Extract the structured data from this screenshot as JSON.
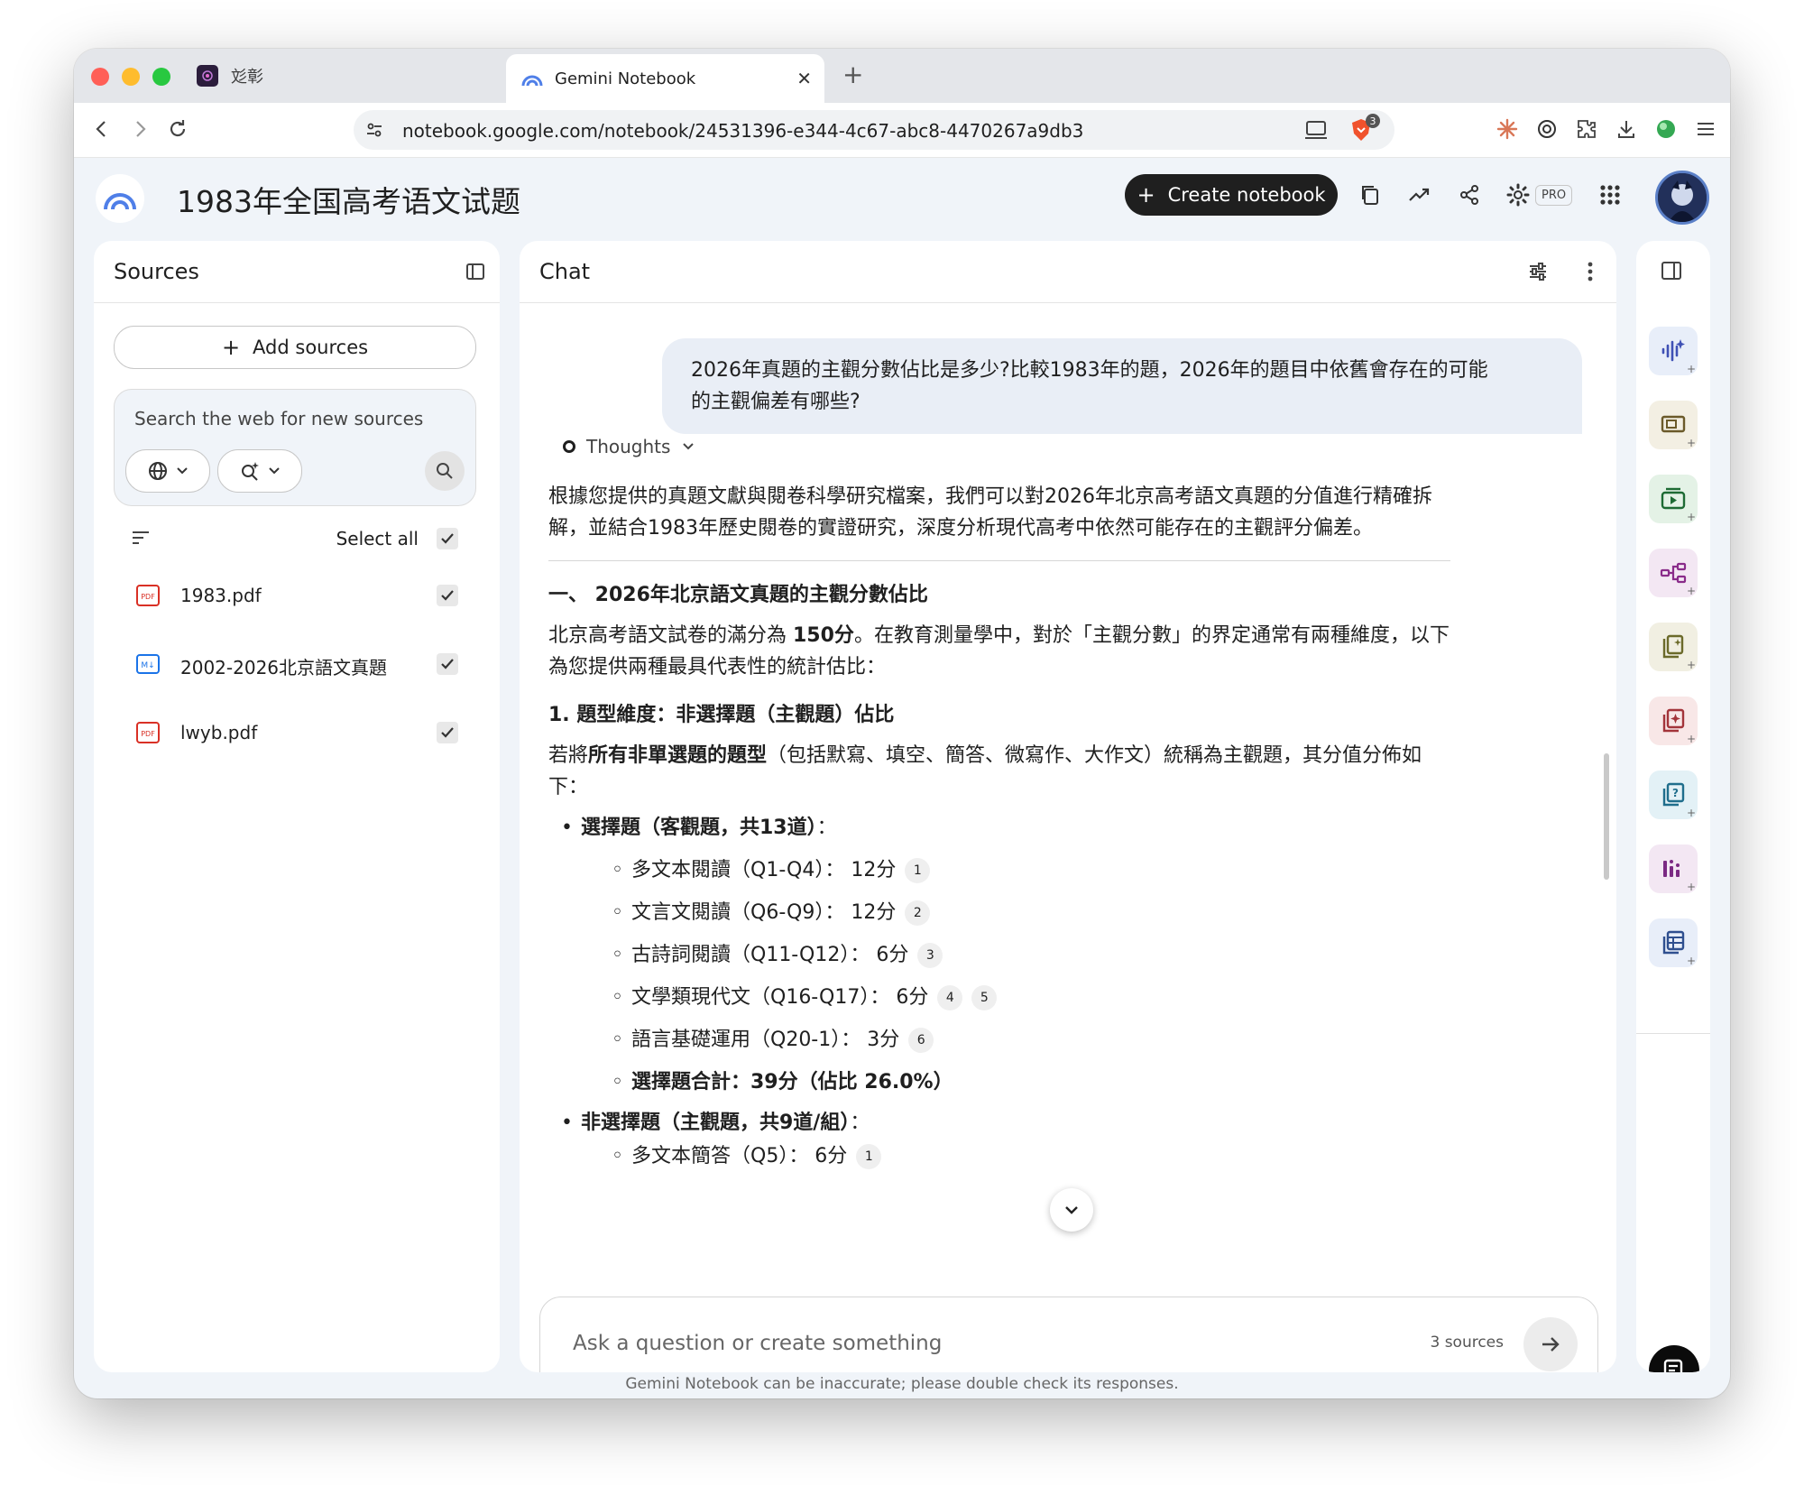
{
  "browser": {
    "inactive_tab_title": "彣彰",
    "active_tab_title": "Gemini Notebook",
    "url": "notebook.google.com/notebook/24531396-e344-4c67-abc8-4470267a9db3",
    "brave_badge": "3"
  },
  "header": {
    "notebook_title": "1983年全国高考语文试题",
    "create_label": "Create notebook",
    "pro_label": "PRO"
  },
  "sources": {
    "title": "Sources",
    "add_label": "Add sources",
    "search_placeholder": "Search the web for new sources",
    "select_all": "Select all",
    "items": [
      {
        "name": "1983.pdf",
        "type": "pdf"
      },
      {
        "name": "2002-2026北京語文真題",
        "type": "markdown"
      },
      {
        "name": "lwyb.pdf",
        "type": "pdf"
      }
    ]
  },
  "chat": {
    "title": "Chat",
    "user_line1": "2026年真題的主觀分數佔比是多少?比較1983年的題，2026年的題目中依舊會存在的可能",
    "user_line2": "的主觀偏差有哪些?",
    "thoughts_label": "Thoughts",
    "intro": "根據您提供的真題文獻與閱卷科學研究檔案，我們可以對2026年北京高考語文真題的分值進行精確拆解，並結合1983年歷史閱卷的實證研究，深度分析現代高考中依然可能存在的主觀評分偏差。",
    "section_heading": "一、 2026年北京語文真題的主觀分數佔比",
    "p1_before": "北京高考語文試卷的滿分為 ",
    "p1_bold": "150分",
    "p1_after": "。在教育測量學中，對於「主觀分數」的界定通常有兩種維度，以下為您提供兩種最具代表性的統計估比：",
    "sub_heading": "1. 題型維度：非選擇題（主觀題）佔比",
    "p2_before": "若將",
    "p2_bold": "所有非單選題的題型",
    "p2_after": "（包括默寫、填空、簡答、微寫作、大作文）統稱為主觀題，其分值分佈如下：",
    "group1_label": "選擇題（客觀題，共13道）",
    "group1_colon": "：",
    "group1_items": [
      {
        "text": "多文本閱讀（Q1-Q4）： 12分",
        "cites": [
          "1"
        ]
      },
      {
        "text": "文言文閱讀（Q6-Q9）： 12分",
        "cites": [
          "2"
        ]
      },
      {
        "text": "古詩詞閱讀（Q11-Q12）： 6分",
        "cites": [
          "3"
        ]
      },
      {
        "text": "文學類現代文（Q16-Q17）： 6分",
        "cites": [
          "4",
          "5"
        ]
      },
      {
        "text": "語言基礎運用（Q20-1）： 3分",
        "cites": [
          "6"
        ]
      }
    ],
    "group1_total": "選擇題合計：39分（佔比 26.0%）",
    "group2_label": "非選擇題（主觀題，共9道/組）",
    "group2_colon": "：",
    "group2_items": [
      {
        "text": "多文本簡答（Q5）： 6分",
        "cites": [
          "1"
        ]
      }
    ],
    "composer_placeholder": "Ask a question or create something",
    "source_count": "3 sources"
  },
  "footer": {
    "disclaimer": "Gemini Notebook can be inaccurate; please double check its responses."
  },
  "studio": {
    "tiles": [
      {
        "icon": "audio-overview-icon",
        "bg": "#e8eef9",
        "color": "#3f51b5"
      },
      {
        "icon": "slides-icon",
        "bg": "#f3efe3",
        "color": "#6b5a2a"
      },
      {
        "icon": "video-overview-icon",
        "bg": "#e4f2e6",
        "color": "#1e6b34"
      },
      {
        "icon": "mind-map-icon",
        "bg": "#f3e7f3",
        "color": "#8a2c8a"
      },
      {
        "icon": "report-icon",
        "bg": "#f1efe2",
        "color": "#6b6a2a"
      },
      {
        "icon": "flashcards-icon",
        "bg": "#f8e7e7",
        "color": "#a3343a"
      },
      {
        "icon": "quiz-icon",
        "bg": "#e3f1f6",
        "color": "#1f6e8c"
      },
      {
        "icon": "infographic-icon",
        "bg": "#f3e7f3",
        "color": "#7b2a83"
      },
      {
        "icon": "data-table-icon",
        "bg": "#e8eef9",
        "color": "#2f4f8f"
      }
    ]
  }
}
